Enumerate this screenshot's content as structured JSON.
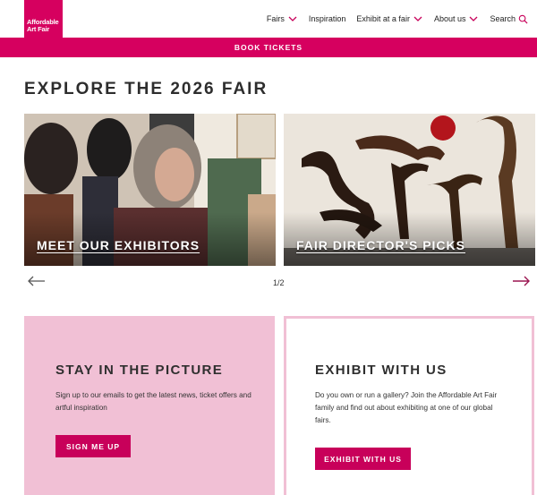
{
  "header": {
    "logo_line1": "Affordable",
    "logo_line2": "Art Fair",
    "nav": [
      {
        "label": "Fairs",
        "has_dropdown": true
      },
      {
        "label": "Inspiration",
        "has_dropdown": false
      },
      {
        "label": "Exhibit at a fair",
        "has_dropdown": true
      },
      {
        "label": "About us",
        "has_dropdown": true
      }
    ],
    "search_label": "Search",
    "icons": {
      "dropdown": "chevron-down-icon",
      "search": "search-icon"
    }
  },
  "book_bar": {
    "label": "BOOK TICKETS"
  },
  "explore": {
    "title": "EXPLORE THE 2026 FAIR",
    "cards": [
      {
        "label": "MEET OUR EXHIBITORS"
      },
      {
        "label": "FAIR DIRECTOR'S PICKS"
      }
    ],
    "pager": "1/2",
    "icons": {
      "prev": "arrow-left-icon",
      "next": "arrow-right-icon"
    }
  },
  "promos": {
    "newsletter": {
      "title": "STAY IN THE PICTURE",
      "text": "Sign up to our emails to get the latest news, ticket offers and artful inspiration",
      "button": "SIGN ME UP"
    },
    "exhibit": {
      "title": "EXHIBIT WITH US",
      "text": "Do you own or run a gallery? Join the Affordable Art Fair family and find out about exhibiting at one of our global fairs.",
      "button": "EXHIBIT WITH US"
    }
  },
  "colors": {
    "brand": "#d6005f",
    "button": "#c8005a",
    "pink_soft": "#f1c0d5",
    "arrow_next": "#9b1550"
  }
}
